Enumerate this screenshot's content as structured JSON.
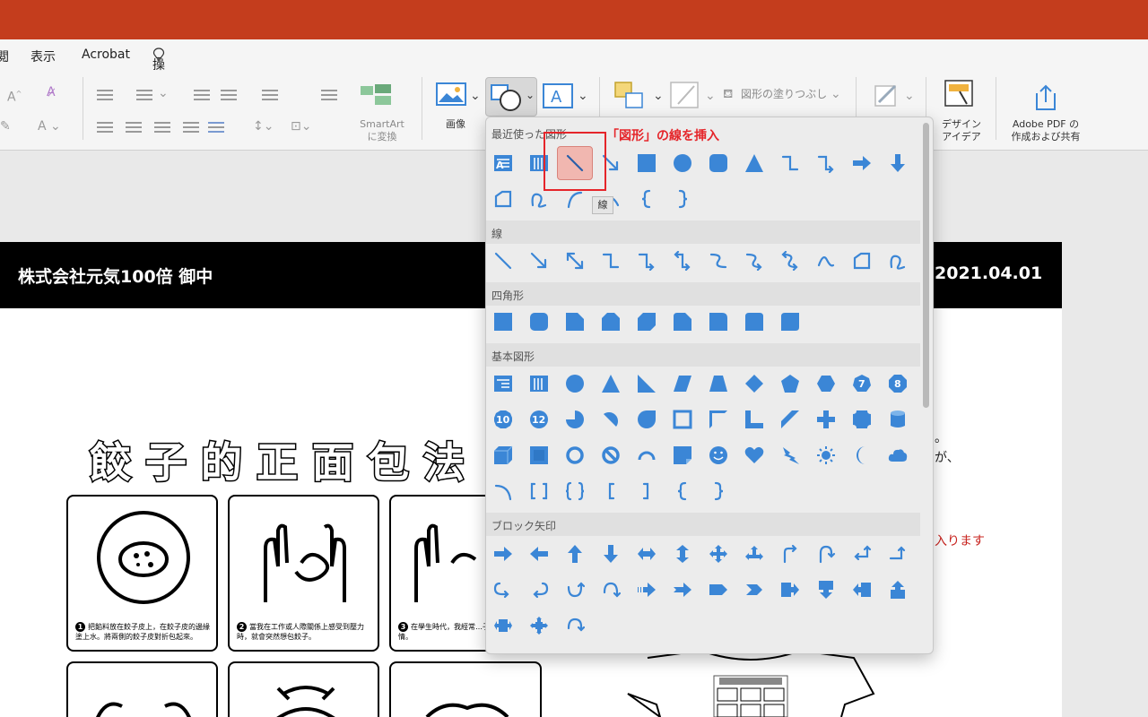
{
  "menubar": {
    "item0": "閲",
    "item1": "表示",
    "item2": "Acrobat",
    "item3": "操作アシスト"
  },
  "ribbon": {
    "smartart_line1": "SmartArt",
    "smartart_line2": "に変換",
    "image_label": "画像",
    "shape_fill_label": "図形の塗りつぶし",
    "design_line1": "デザイン",
    "design_line2": "アイデア",
    "adobe_line1": "Adobe PDF の",
    "adobe_line2": "作成および共有"
  },
  "dropdown": {
    "sections": {
      "recent": "最近使った図形",
      "lines": "線",
      "rectangles": "四角形",
      "basic": "基本図形",
      "block_arrows": "ブロック矢印"
    },
    "badges": [
      "7",
      "8",
      "10",
      "12"
    ],
    "tooltip": "線"
  },
  "annotation": {
    "text": "「図形」の線を挿入",
    "color": "#e5252a"
  },
  "slide": {
    "client": "株式会社元気100倍 御中",
    "date": "2021.04.01",
    "poster_title": "餃子的正面包法",
    "captions": [
      {
        "num": "1",
        "text": "把餡料放在餃子皮上，在餃子皮的邊緣塗上水。將兩側的餃子皮對折包起來。"
      },
      {
        "num": "2",
        "text": "當我在工作或人際關係上感受到壓力時，就會突然想包餃子。"
      },
      {
        "num": "3",
        "text": "在學生時代，我經常…子，來轉換心情。"
      }
    ],
    "side_text_1": "。",
    "side_text_2": "が、",
    "side_red": "入ります"
  },
  "colors": {
    "titlebar": "#c43d1d",
    "shape_blue": "#3b86d6",
    "highlight_red": "#e5252a"
  }
}
